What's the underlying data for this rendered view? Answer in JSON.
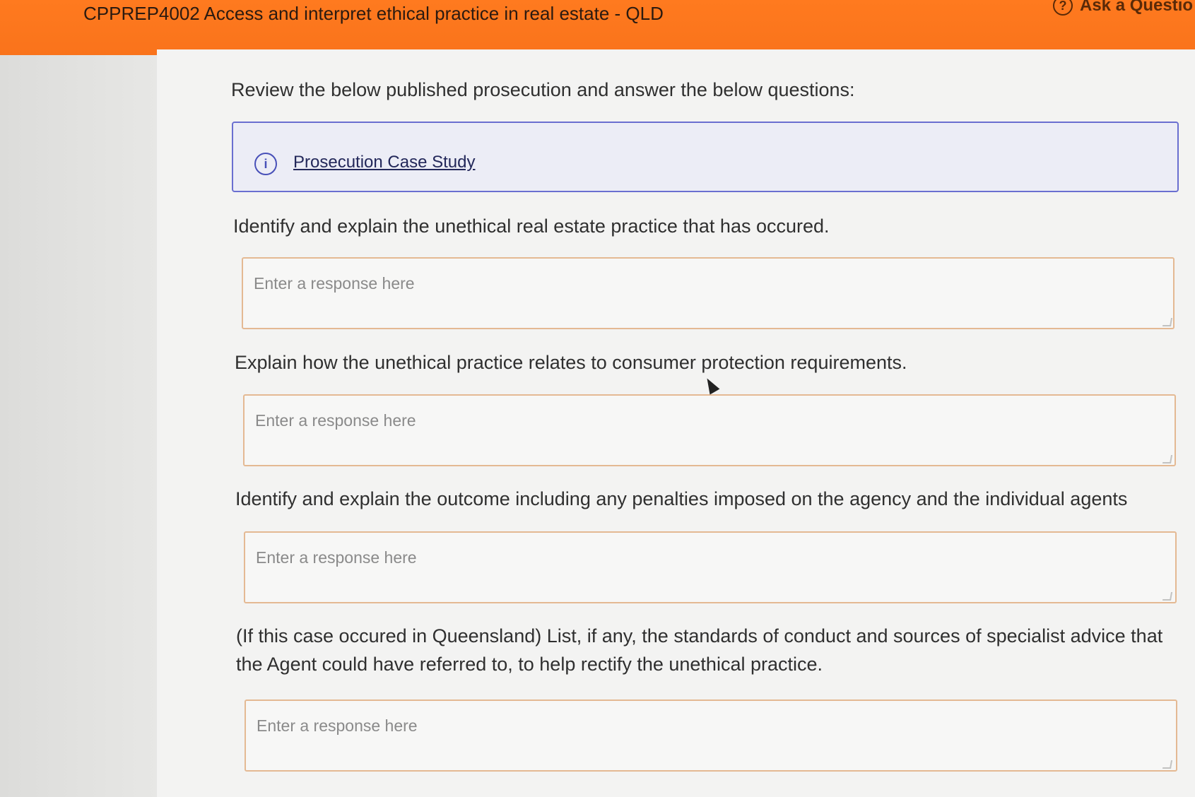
{
  "header": {
    "course_title": "CPPREP4002 Access and interpret ethical practice in real estate - QLD",
    "ask_label": "Ask a Questio",
    "ask_icon": "help-circle-icon",
    "accent_color": "#f9731b"
  },
  "intro_text": "Review the below published prosecution and answer the below questions:",
  "case_study": {
    "icon": "info-icon",
    "link_label": "Prosecution Case Study"
  },
  "questions": [
    {
      "prompt": "Identify and explain the unethical real estate practice that has occured.",
      "placeholder": "Enter a response here"
    },
    {
      "prompt": "Explain how the unethical practice relates to consumer protection requirements.",
      "placeholder": "Enter a response here"
    },
    {
      "prompt": "Identify and explain the outcome including any penalties imposed on the agency and the individual agents",
      "placeholder": "Enter a response here"
    },
    {
      "prompt": "(If this case occured in Queensland) List, if any, the standards of conduct and sources of specialist advice that the Agent could have referred to, to help rectify the unethical practice.",
      "placeholder": "Enter a response here"
    }
  ]
}
